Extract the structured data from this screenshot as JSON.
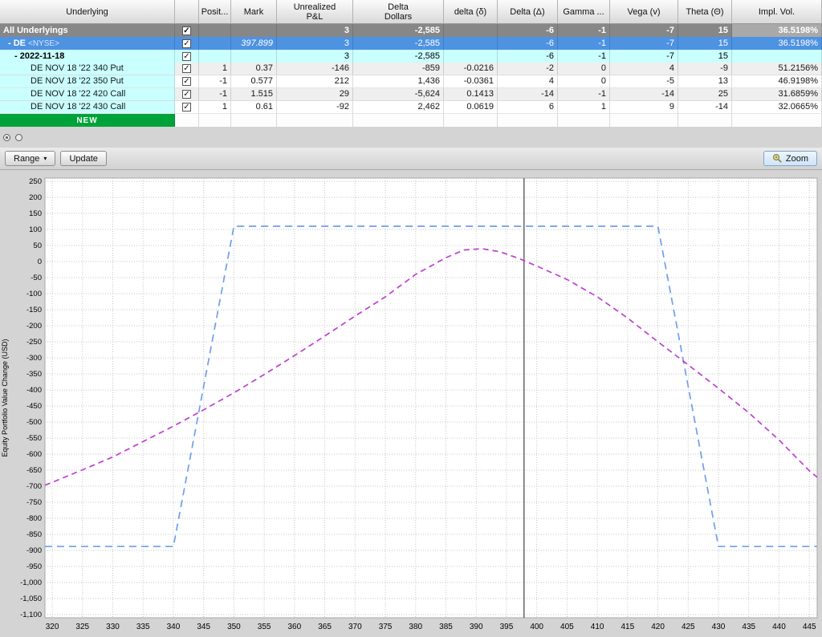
{
  "colors": {
    "group_row_bg": "#878787",
    "group_impl_bg": "#a9a9a9",
    "selected_row_bg": "#4e92e2",
    "date_row_bg": "#c9ffff",
    "leg_label_bg": "#c9ffff",
    "new_row_bg": "#00a33a",
    "grid_line": "#c6c6c6",
    "price_marker": "#404040"
  },
  "positions_table": {
    "columns": [
      {
        "key": "underlying",
        "label": "Underlying"
      },
      {
        "key": "check",
        "label": ""
      },
      {
        "key": "position",
        "label": "Posit..."
      },
      {
        "key": "mark",
        "label": "Mark"
      },
      {
        "key": "unrealized_pnl",
        "label": "Unrealized\nP&L"
      },
      {
        "key": "delta_dollars",
        "label": "Delta\nDollars"
      },
      {
        "key": "delta_lower",
        "label": "delta (δ)"
      },
      {
        "key": "delta_upper",
        "label": "Delta (Δ)"
      },
      {
        "key": "gamma",
        "label": "Gamma ..."
      },
      {
        "key": "vega",
        "label": "Vega (v)"
      },
      {
        "key": "theta",
        "label": "Theta (Θ)"
      },
      {
        "key": "impl_vol",
        "label": "Impl. Vol."
      }
    ],
    "rows": [
      {
        "style": "group",
        "indent": 0,
        "label": "All Underlyings",
        "exchange": "",
        "checked": true,
        "position": "",
        "mark": "",
        "unrealized_pnl": "3",
        "delta_dollars": "-2,585",
        "delta_lower": "",
        "delta_upper": "-6",
        "gamma": "-1",
        "vega": "-7",
        "theta": "15",
        "impl_vol": "36.5198%"
      },
      {
        "style": "selected",
        "indent": 1,
        "label": "- DE",
        "exchange": "<NYSE>",
        "checked": true,
        "position": "",
        "mark": "397.899",
        "unrealized_pnl": "3",
        "delta_dollars": "-2,585",
        "delta_lower": "",
        "delta_upper": "-6",
        "gamma": "-1",
        "vega": "-7",
        "theta": "15",
        "impl_vol": "36.5198%"
      },
      {
        "style": "date",
        "indent": 2,
        "label": "- 2022-11-18",
        "exchange": "",
        "checked": true,
        "position": "",
        "mark": "",
        "unrealized_pnl": "3",
        "delta_dollars": "-2,585",
        "delta_lower": "",
        "delta_upper": "-6",
        "gamma": "-1",
        "vega": "-7",
        "theta": "15",
        "impl_vol": ""
      },
      {
        "style": "leg-even",
        "indent": 3,
        "label": "DE NOV 18 '22 340 Put",
        "exchange": "",
        "checked": true,
        "position": "1",
        "mark": "0.37",
        "unrealized_pnl": "-146",
        "delta_dollars": "-859",
        "delta_lower": "-0.0216",
        "delta_upper": "-2",
        "gamma": "0",
        "vega": "4",
        "theta": "-9",
        "impl_vol": "51.2156%"
      },
      {
        "style": "leg-odd",
        "indent": 3,
        "label": "DE NOV 18 '22 350 Put",
        "exchange": "",
        "checked": true,
        "position": "-1",
        "mark": "0.577",
        "unrealized_pnl": "212",
        "delta_dollars": "1,436",
        "delta_lower": "-0.0361",
        "delta_upper": "4",
        "gamma": "0",
        "vega": "-5",
        "theta": "13",
        "impl_vol": "46.9198%"
      },
      {
        "style": "leg-even",
        "indent": 3,
        "label": "DE NOV 18 '22 420 Call",
        "exchange": "",
        "checked": true,
        "position": "-1",
        "mark": "1.515",
        "unrealized_pnl": "29",
        "delta_dollars": "-5,624",
        "delta_lower": "0.1413",
        "delta_upper": "-14",
        "gamma": "-1",
        "vega": "-14",
        "theta": "25",
        "impl_vol": "31.6859%"
      },
      {
        "style": "leg-odd",
        "indent": 3,
        "label": "DE NOV 18 '22 430 Call",
        "exchange": "",
        "checked": true,
        "position": "1",
        "mark": "0.61",
        "unrealized_pnl": "-92",
        "delta_dollars": "2,462",
        "delta_lower": "0.0619",
        "delta_upper": "6",
        "gamma": "1",
        "vega": "9",
        "theta": "-14",
        "impl_vol": "32.0665%"
      },
      {
        "style": "new",
        "indent": 0,
        "label": "NEW",
        "exchange": "",
        "checked": null,
        "position": "",
        "mark": "",
        "unrealized_pnl": "",
        "delta_dollars": "",
        "delta_lower": "",
        "delta_upper": "",
        "gamma": "",
        "vega": "",
        "theta": "",
        "impl_vol": ""
      }
    ]
  },
  "toolbar": {
    "range_label": "Range",
    "range_caret": "▾",
    "update_label": "Update",
    "zoom_label": "Zoom"
  },
  "chart_data": {
    "type": "line",
    "title": "",
    "xlabel": "",
    "ylabel": "Equity Portfolio Value Change (USD)",
    "xlim": [
      318.8,
      446.3
    ],
    "ylim": [
      -1110,
      260
    ],
    "grid": true,
    "grid_style": "dotted",
    "legend": false,
    "price_marker_x": 397.899,
    "x_ticks": [
      320,
      325,
      330,
      335,
      340,
      345,
      350,
      355,
      360,
      365,
      370,
      375,
      380,
      385,
      390,
      395,
      400,
      405,
      410,
      415,
      420,
      425,
      430,
      435,
      440,
      445
    ],
    "y_ticks": [
      250,
      200,
      150,
      100,
      50,
      0,
      -50,
      -100,
      -150,
      -200,
      -250,
      -300,
      -350,
      -400,
      -450,
      -500,
      -550,
      -600,
      -650,
      -700,
      -750,
      -800,
      -850,
      -900,
      -950,
      -1000,
      -1050,
      -1100
    ],
    "series": [
      {
        "name": "expiration-payoff",
        "color": "#6f9fe8",
        "dash": "9,6",
        "points": [
          [
            318.8,
            -888
          ],
          [
            340,
            -888
          ],
          [
            350,
            110
          ],
          [
            420,
            110
          ],
          [
            430,
            -888
          ],
          [
            446.3,
            -888
          ]
        ]
      },
      {
        "name": "current-value",
        "color": "#bf3fd0",
        "dash": "7,5",
        "points": [
          [
            318.8,
            -697
          ],
          [
            320,
            -688
          ],
          [
            325,
            -649
          ],
          [
            330,
            -609
          ],
          [
            335,
            -561
          ],
          [
            340,
            -513
          ],
          [
            345,
            -462
          ],
          [
            350,
            -409
          ],
          [
            355,
            -352
          ],
          [
            360,
            -293
          ],
          [
            365,
            -232
          ],
          [
            370,
            -170
          ],
          [
            375,
            -110
          ],
          [
            380,
            -40
          ],
          [
            385,
            12
          ],
          [
            388,
            36
          ],
          [
            391,
            40
          ],
          [
            394,
            30
          ],
          [
            397,
            10
          ],
          [
            400,
            -14
          ],
          [
            405,
            -56
          ],
          [
            410,
            -110
          ],
          [
            415,
            -176
          ],
          [
            420,
            -250
          ],
          [
            425,
            -322
          ],
          [
            430,
            -395
          ],
          [
            435,
            -471
          ],
          [
            440,
            -556
          ],
          [
            445,
            -652
          ],
          [
            446.3,
            -672
          ]
        ]
      }
    ]
  }
}
